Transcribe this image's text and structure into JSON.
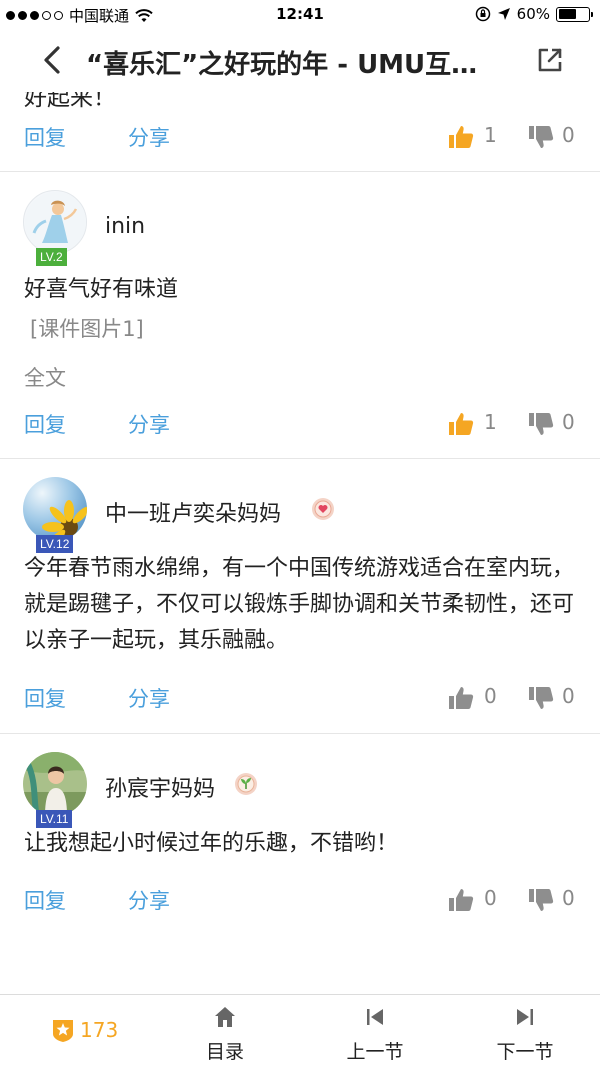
{
  "status_bar": {
    "carrier": "中国联通",
    "time": "12:41",
    "battery": "60%",
    "signal_dots_filled": 3,
    "signal_dots_total": 5
  },
  "nav": {
    "title": "“喜乐汇”之好玩的年 - UMU互…",
    "back_icon": "chevron-left-icon",
    "share_icon": "external-link-icon"
  },
  "partial_comment": {
    "text_fragment": "好起来！",
    "actions": {
      "reply": "回复",
      "share": "分享",
      "likes": "1",
      "dislikes": "0",
      "liked": true
    }
  },
  "comments": [
    {
      "username": "inin",
      "level": "LV.2",
      "level_color": "#4caf3c",
      "text": "好喜气好有味道",
      "attachment": "[课件图片1]",
      "fulltext_link": "全文",
      "actions": {
        "reply": "回复",
        "share": "分享",
        "likes": "1",
        "dislikes": "0",
        "liked": true
      }
    },
    {
      "username": "中一班卢奕朵妈妈",
      "level": "LV.12",
      "level_color": "#3a57b8",
      "medal": "heart-medal-icon",
      "text": "今年春节雨水绵绵，有一个中国传统游戏适合在室内玩，就是踢毽子，不仅可以锻炼手脚协调和关节柔韧性，还可以亲子一起玩，其乐融融。",
      "actions": {
        "reply": "回复",
        "share": "分享",
        "likes": "0",
        "dislikes": "0",
        "liked": false
      }
    },
    {
      "username": "孙宸宇妈妈",
      "level": "LV.11",
      "level_color": "#3a57b8",
      "medal": "sprout-medal-icon",
      "text": "让我想起小时候过年的乐趣，不错哟！",
      "actions": {
        "reply": "回复",
        "share": "分享",
        "likes": "0",
        "dislikes": "0",
        "liked": false
      }
    }
  ],
  "bottom_bar": {
    "points": "173",
    "tabs": [
      {
        "label": "目录",
        "icon": "home-icon"
      },
      {
        "label": "上一节",
        "icon": "skip-previous-icon"
      },
      {
        "label": "下一节",
        "icon": "skip-next-icon"
      }
    ]
  },
  "colors": {
    "link_blue": "#4a9fdc",
    "like_active": "#f5a623",
    "icon_gray": "#8e8e8e"
  }
}
